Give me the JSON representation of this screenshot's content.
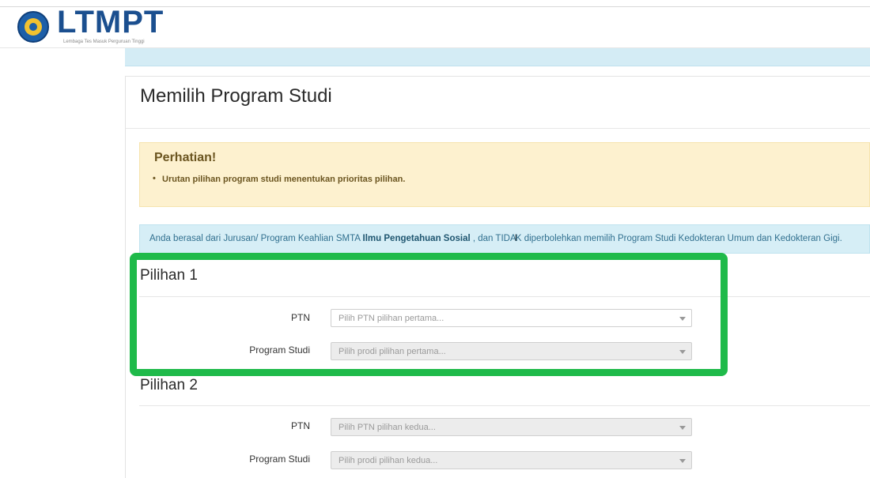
{
  "header": {
    "logo_text": "LTMPT",
    "logo_subtitle": "Lembaga Tes Masuk Perguruan Tinggi"
  },
  "page": {
    "title": "Memilih Program Studi"
  },
  "warning": {
    "title": "Perhatian!",
    "item": "Urutan pilihan program studi menentukan prioritas pilihan."
  },
  "info": {
    "prefix": "Anda berasal dari Jurusan/ Program Keahlian SMTA ",
    "major": "Ilmu Pengetahuan Sosial",
    "middle": " , dan TIDA",
    "suffix": "K diperbolehkan memilih Program Studi Kedokteran Umum dan Kedokteran Gigi."
  },
  "pilihan1": {
    "title": "Pilihan 1",
    "ptn_label": "PTN",
    "ptn_placeholder": "Pilih PTN pilihan pertama...",
    "prodi_label": "Program Studi",
    "prodi_placeholder": "Pilih prodi pilihan pertama..."
  },
  "pilihan2": {
    "title": "Pilihan 2",
    "ptn_label": "PTN",
    "ptn_placeholder": "Pilih PTN pilihan kedua...",
    "prodi_label": "Program Studi",
    "prodi_placeholder": "Pilih prodi pilihan kedua..."
  },
  "colors": {
    "highlight": "#1fba4a",
    "brand": "#1b4f8f",
    "warning_bg": "#fdf1cf",
    "info_bg": "#d6eef6"
  }
}
